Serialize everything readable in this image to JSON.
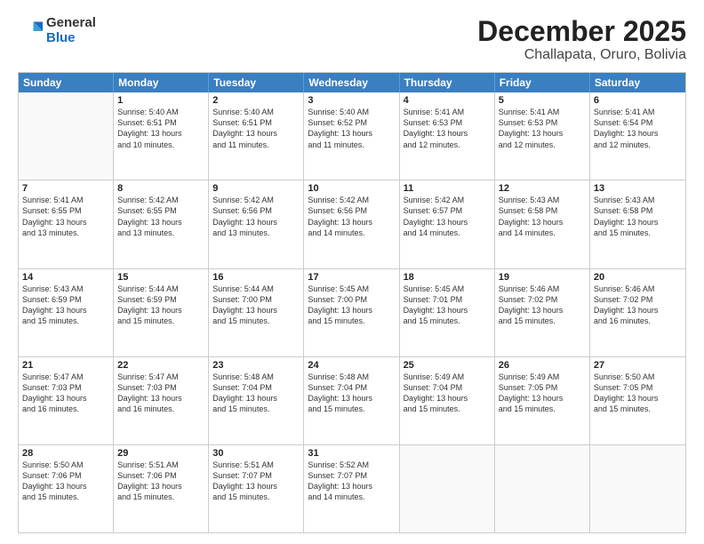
{
  "logo": {
    "general": "General",
    "blue": "Blue"
  },
  "title": "December 2025",
  "location": "Challapata, Oruro, Bolivia",
  "header_days": [
    "Sunday",
    "Monday",
    "Tuesday",
    "Wednesday",
    "Thursday",
    "Friday",
    "Saturday"
  ],
  "weeks": [
    [
      {
        "day": "",
        "text": ""
      },
      {
        "day": "1",
        "text": "Sunrise: 5:40 AM\nSunset: 6:51 PM\nDaylight: 13 hours\nand 10 minutes."
      },
      {
        "day": "2",
        "text": "Sunrise: 5:40 AM\nSunset: 6:51 PM\nDaylight: 13 hours\nand 11 minutes."
      },
      {
        "day": "3",
        "text": "Sunrise: 5:40 AM\nSunset: 6:52 PM\nDaylight: 13 hours\nand 11 minutes."
      },
      {
        "day": "4",
        "text": "Sunrise: 5:41 AM\nSunset: 6:53 PM\nDaylight: 13 hours\nand 12 minutes."
      },
      {
        "day": "5",
        "text": "Sunrise: 5:41 AM\nSunset: 6:53 PM\nDaylight: 13 hours\nand 12 minutes."
      },
      {
        "day": "6",
        "text": "Sunrise: 5:41 AM\nSunset: 6:54 PM\nDaylight: 13 hours\nand 12 minutes."
      }
    ],
    [
      {
        "day": "7",
        "text": "Sunrise: 5:41 AM\nSunset: 6:55 PM\nDaylight: 13 hours\nand 13 minutes."
      },
      {
        "day": "8",
        "text": "Sunrise: 5:42 AM\nSunset: 6:55 PM\nDaylight: 13 hours\nand 13 minutes."
      },
      {
        "day": "9",
        "text": "Sunrise: 5:42 AM\nSunset: 6:56 PM\nDaylight: 13 hours\nand 13 minutes."
      },
      {
        "day": "10",
        "text": "Sunrise: 5:42 AM\nSunset: 6:56 PM\nDaylight: 13 hours\nand 14 minutes."
      },
      {
        "day": "11",
        "text": "Sunrise: 5:42 AM\nSunset: 6:57 PM\nDaylight: 13 hours\nand 14 minutes."
      },
      {
        "day": "12",
        "text": "Sunrise: 5:43 AM\nSunset: 6:58 PM\nDaylight: 13 hours\nand 14 minutes."
      },
      {
        "day": "13",
        "text": "Sunrise: 5:43 AM\nSunset: 6:58 PM\nDaylight: 13 hours\nand 15 minutes."
      }
    ],
    [
      {
        "day": "14",
        "text": "Sunrise: 5:43 AM\nSunset: 6:59 PM\nDaylight: 13 hours\nand 15 minutes."
      },
      {
        "day": "15",
        "text": "Sunrise: 5:44 AM\nSunset: 6:59 PM\nDaylight: 13 hours\nand 15 minutes."
      },
      {
        "day": "16",
        "text": "Sunrise: 5:44 AM\nSunset: 7:00 PM\nDaylight: 13 hours\nand 15 minutes."
      },
      {
        "day": "17",
        "text": "Sunrise: 5:45 AM\nSunset: 7:00 PM\nDaylight: 13 hours\nand 15 minutes."
      },
      {
        "day": "18",
        "text": "Sunrise: 5:45 AM\nSunset: 7:01 PM\nDaylight: 13 hours\nand 15 minutes."
      },
      {
        "day": "19",
        "text": "Sunrise: 5:46 AM\nSunset: 7:02 PM\nDaylight: 13 hours\nand 15 minutes."
      },
      {
        "day": "20",
        "text": "Sunrise: 5:46 AM\nSunset: 7:02 PM\nDaylight: 13 hours\nand 16 minutes."
      }
    ],
    [
      {
        "day": "21",
        "text": "Sunrise: 5:47 AM\nSunset: 7:03 PM\nDaylight: 13 hours\nand 16 minutes."
      },
      {
        "day": "22",
        "text": "Sunrise: 5:47 AM\nSunset: 7:03 PM\nDaylight: 13 hours\nand 16 minutes."
      },
      {
        "day": "23",
        "text": "Sunrise: 5:48 AM\nSunset: 7:04 PM\nDaylight: 13 hours\nand 15 minutes."
      },
      {
        "day": "24",
        "text": "Sunrise: 5:48 AM\nSunset: 7:04 PM\nDaylight: 13 hours\nand 15 minutes."
      },
      {
        "day": "25",
        "text": "Sunrise: 5:49 AM\nSunset: 7:04 PM\nDaylight: 13 hours\nand 15 minutes."
      },
      {
        "day": "26",
        "text": "Sunrise: 5:49 AM\nSunset: 7:05 PM\nDaylight: 13 hours\nand 15 minutes."
      },
      {
        "day": "27",
        "text": "Sunrise: 5:50 AM\nSunset: 7:05 PM\nDaylight: 13 hours\nand 15 minutes."
      }
    ],
    [
      {
        "day": "28",
        "text": "Sunrise: 5:50 AM\nSunset: 7:06 PM\nDaylight: 13 hours\nand 15 minutes."
      },
      {
        "day": "29",
        "text": "Sunrise: 5:51 AM\nSunset: 7:06 PM\nDaylight: 13 hours\nand 15 minutes."
      },
      {
        "day": "30",
        "text": "Sunrise: 5:51 AM\nSunset: 7:07 PM\nDaylight: 13 hours\nand 15 minutes."
      },
      {
        "day": "31",
        "text": "Sunrise: 5:52 AM\nSunset: 7:07 PM\nDaylight: 13 hours\nand 14 minutes."
      },
      {
        "day": "",
        "text": ""
      },
      {
        "day": "",
        "text": ""
      },
      {
        "day": "",
        "text": ""
      }
    ]
  ]
}
